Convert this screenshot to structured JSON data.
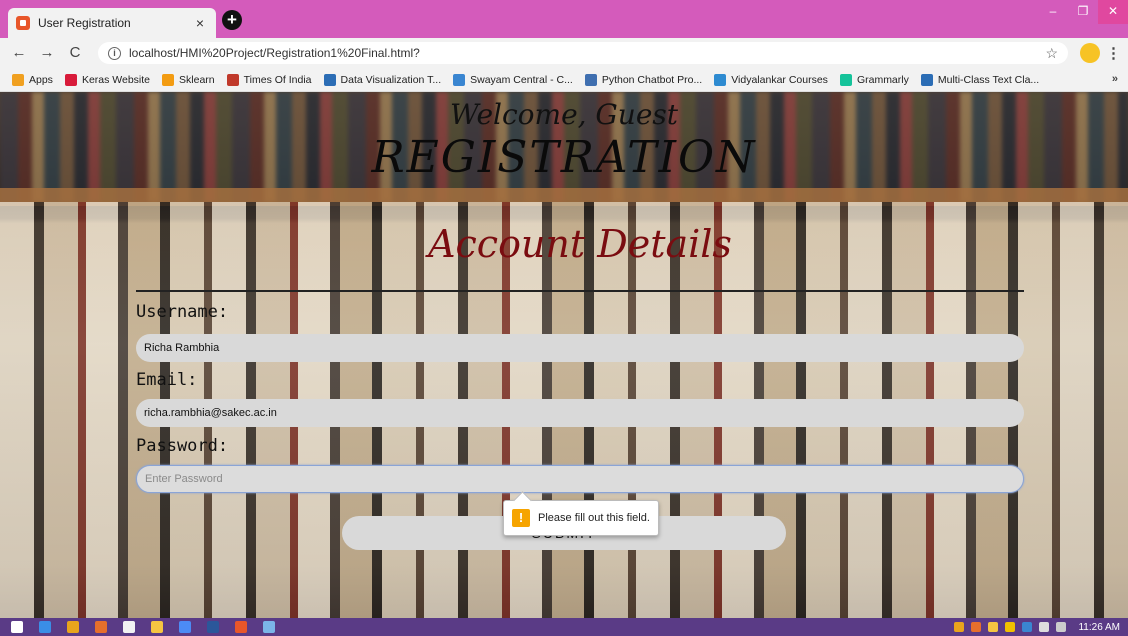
{
  "browser": {
    "tab_title": "User Registration",
    "tab_close": "×",
    "new_tab": "+",
    "url": "localhost/HMI%20Project/Registration1%20Final.html?",
    "window": {
      "minimize": "–",
      "maximize": "❐",
      "close": "✕"
    },
    "nav": {
      "back": "←",
      "forward": "→",
      "reload": "C",
      "star": "☆",
      "menu": "⋮"
    }
  },
  "bookmarks": {
    "items": [
      {
        "label": "Apps",
        "color": "#f0a020"
      },
      {
        "label": "Keras Website",
        "color": "#d81b3a"
      },
      {
        "label": "Sklearn",
        "color": "#f39c12"
      },
      {
        "label": "Times Of India",
        "color": "#c0392b"
      },
      {
        "label": "Data Visualization T...",
        "color": "#2c6db5"
      },
      {
        "label": "Swayam Central - C...",
        "color": "#3a86d1"
      },
      {
        "label": "Python Chatbot Pro...",
        "color": "#3f6fb0"
      },
      {
        "label": "Vidyalankar Courses",
        "color": "#2e8bd1"
      },
      {
        "label": "Grammarly",
        "color": "#15c39a"
      },
      {
        "label": "Multi-Class Text Cla...",
        "color": "#2c6db5"
      }
    ],
    "more": "»"
  },
  "page": {
    "welcome": "Welcome, Guest",
    "title": "REGISTRATION",
    "section_title": "Account Details",
    "username_label": "Username:",
    "username_value": "Richa Rambhia",
    "email_label": "Email:",
    "email_value": "richa.rambhia@sakec.ac.in",
    "password_label": "Password:",
    "password_placeholder": "Enter Password",
    "submit_label": "SUBMIT",
    "validation_message": "Please fill out this field.",
    "warning_glyph": "!"
  },
  "taskbar": {
    "time": "11:26 AM",
    "apps": [
      {
        "name": "start-icon",
        "color": "#ffffff"
      },
      {
        "name": "edge-icon",
        "color": "#3a8ee6"
      },
      {
        "name": "chrome-icon",
        "color": "#e8a41c"
      },
      {
        "name": "app-icon",
        "color": "#e66f2c"
      },
      {
        "name": "app-icon",
        "color": "#f2f2f2"
      },
      {
        "name": "folder-icon",
        "color": "#f5c542"
      },
      {
        "name": "chrome-icon",
        "color": "#4c8bf5"
      },
      {
        "name": "word-icon",
        "color": "#2b579a"
      },
      {
        "name": "app-icon",
        "color": "#e8562a"
      },
      {
        "name": "app-icon",
        "color": "#7bb5e8"
      }
    ]
  }
}
